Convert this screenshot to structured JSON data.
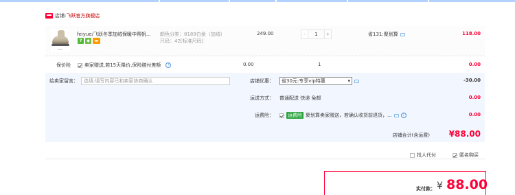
{
  "colors": {
    "accent": "#ff0036",
    "tab_line": "#b2d1ff",
    "summary_bg": "#f2f7ff",
    "link_blue": "#4e8fe0"
  },
  "shop": {
    "label": "店铺:",
    "name": "飞跃官方旗舰店",
    "icon": "shop-icon"
  },
  "item": {
    "title": "feiyue/飞跃冬季加绒保暖中帮帆...",
    "badges": [
      "7",
      "",
      ""
    ],
    "sku_color": "颜色分类：8189白金（加绒）",
    "sku_size": "尺码：42[标准尺码]",
    "unit_price": "249.00",
    "quantity": "1",
    "minus": "-",
    "plus": "+",
    "promo": "省131:聚划算",
    "total": "118.00"
  },
  "insurance": {
    "label": "保价险",
    "option": "卖家赠送,若15天降价,保险赔付差额",
    "price": "0.00",
    "qty": "1",
    "amount": "0.00"
  },
  "summary": {
    "message_label": "给卖家留言：",
    "message_placeholder": "选填:填写内容已和卖家协商确认",
    "discount_label": "店铺优惠：",
    "discount_value": "省30元:专享vip特惠",
    "discount_amount": "-30.00",
    "shipping_label": "运送方式：",
    "shipping_value": "普通配送 快递 免邮",
    "shipping_amount": "0.00",
    "freight_label": "运费险：",
    "freight_tag": "运费险",
    "freight_text": "聚划算卖家赠送，若确认收货前退货，...",
    "freight_amount": "0.00"
  },
  "shop_total": {
    "label": "店铺合计(含运费)",
    "value": "¥88.00"
  },
  "options": {
    "proxy_pay": "找人代付",
    "anonymous": "匿名购买"
  },
  "payment": {
    "label": "实付款：",
    "symbol": "¥",
    "value": "88.00"
  }
}
